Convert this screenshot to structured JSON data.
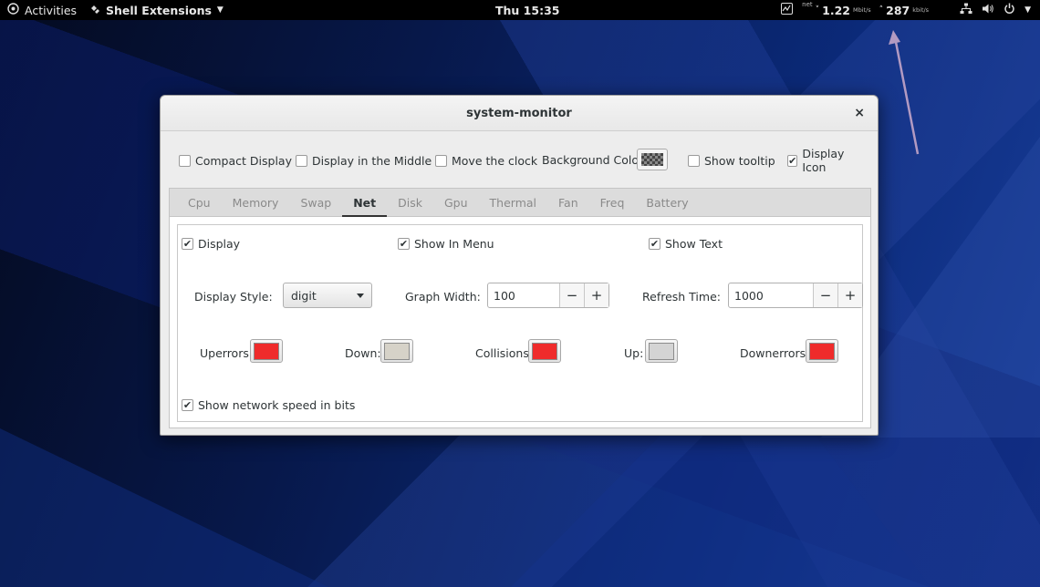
{
  "topbar": {
    "activities": "Activities",
    "app_menu": "Shell Extensions",
    "clock": "Thu 15:35",
    "net_label": "net",
    "down_value": "1.22",
    "down_unit": "Mbit/s",
    "up_value": "287",
    "up_unit": "kbit/s"
  },
  "window": {
    "title": "system-monitor",
    "close": "×"
  },
  "global": {
    "compact_display": {
      "label": "Compact Display",
      "checked": false
    },
    "display_middle": {
      "label": "Display in the Middle",
      "checked": false
    },
    "move_clock": {
      "label": "Move the clock",
      "checked": false
    },
    "background_color_label": "Background Color:",
    "show_tooltip": {
      "label": "Show tooltip",
      "checked": false
    },
    "display_icon": {
      "label": "Display Icon",
      "checked": true
    }
  },
  "tabs": [
    {
      "label": "Cpu",
      "active": false
    },
    {
      "label": "Memory",
      "active": false
    },
    {
      "label": "Swap",
      "active": false
    },
    {
      "label": "Net",
      "active": true
    },
    {
      "label": "Disk",
      "active": false
    },
    {
      "label": "Gpu",
      "active": false
    },
    {
      "label": "Thermal",
      "active": false
    },
    {
      "label": "Fan",
      "active": false
    },
    {
      "label": "Freq",
      "active": false
    },
    {
      "label": "Battery",
      "active": false
    }
  ],
  "net": {
    "display": {
      "label": "Display",
      "checked": true
    },
    "show_in_menu": {
      "label": "Show In Menu",
      "checked": true
    },
    "show_text": {
      "label": "Show Text",
      "checked": true
    },
    "display_style_label": "Display Style:",
    "display_style_value": "digit",
    "graph_width_label": "Graph Width:",
    "graph_width_value": "100",
    "refresh_time_label": "Refresh Time:",
    "refresh_time_value": "1000",
    "minus": "−",
    "plus": "+",
    "colors": {
      "uperrors": {
        "label": "Uperrors:",
        "color": "#ef2b2b"
      },
      "down": {
        "label": "Down:",
        "color": "#d6d2c8"
      },
      "collisions": {
        "label": "Collisions:",
        "color": "#ef2b2b"
      },
      "up": {
        "label": "Up:",
        "color": "#d4d4d4"
      },
      "downerrors": {
        "label": "Downerrors:",
        "color": "#ef2b2b"
      }
    },
    "show_speed_bits": {
      "label": "Show network speed in bits",
      "checked": true
    }
  }
}
